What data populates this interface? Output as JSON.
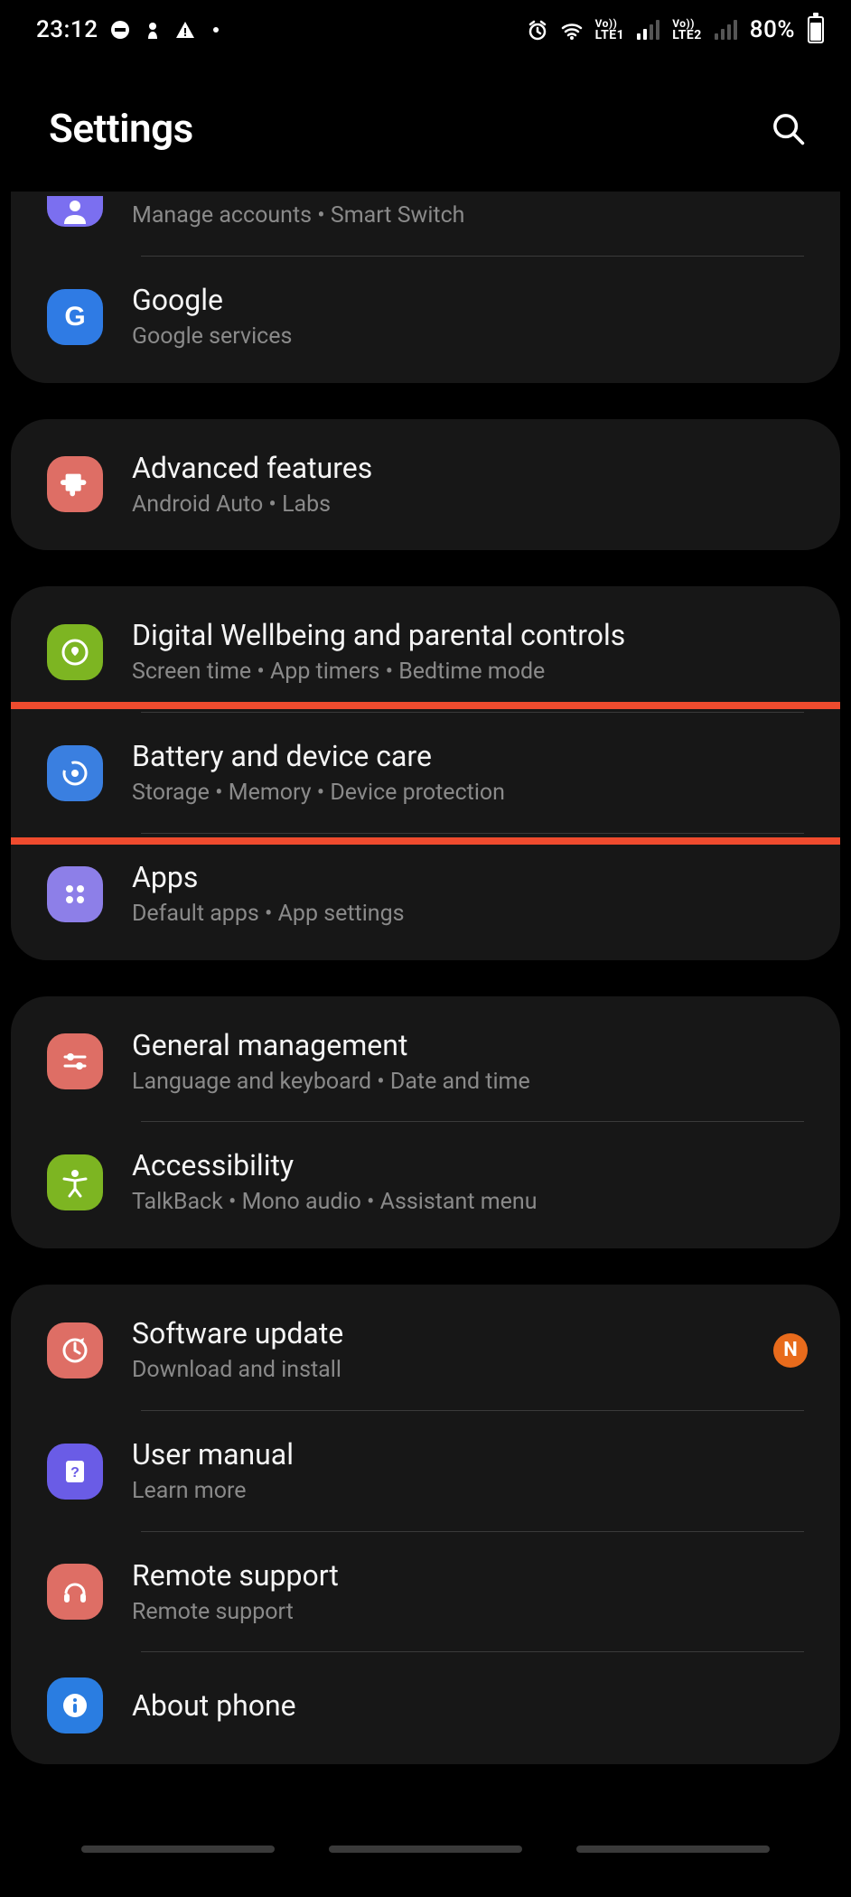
{
  "status": {
    "time": "23:12",
    "battery_pct": "80%",
    "lte1": "LTE1",
    "lte2": "LTE2",
    "vo1": "Vo))",
    "vo2": "Vo))"
  },
  "header": {
    "title": "Settings"
  },
  "groups": [
    {
      "id": "accounts-group",
      "first": true,
      "rows": [
        {
          "id": "accounts",
          "partial": true,
          "icon": "person-icon",
          "icon_color": "c-purple",
          "title": "",
          "subtitle": "Manage accounts  •  Smart Switch"
        },
        {
          "id": "google",
          "icon": "google-icon",
          "icon_color": "c-blue-g",
          "title": "Google",
          "subtitle": "Google services"
        }
      ]
    },
    {
      "id": "advanced-group",
      "rows": [
        {
          "id": "advanced-features",
          "icon": "puzzle-icon",
          "icon_color": "c-coral",
          "title": "Advanced features",
          "subtitle": "Android Auto  •  Labs"
        }
      ]
    },
    {
      "id": "wellbeing-group",
      "rows": [
        {
          "id": "digital-wellbeing",
          "icon": "wellbeing-icon",
          "icon_color": "c-green",
          "title": "Digital Wellbeing and parental controls",
          "subtitle": "Screen time  •  App timers  •  Bedtime mode"
        },
        {
          "id": "battery-device-care",
          "highlighted": true,
          "icon": "care-icon",
          "icon_color": "c-blue",
          "title": "Battery and device care",
          "subtitle": "Storage  •  Memory  •  Device protection"
        },
        {
          "id": "apps",
          "icon": "apps-icon",
          "icon_color": "c-lavender",
          "title": "Apps",
          "subtitle": "Default apps  •  App settings"
        }
      ]
    },
    {
      "id": "general-group",
      "rows": [
        {
          "id": "general-management",
          "icon": "sliders-icon",
          "icon_color": "c-coral",
          "title": "General management",
          "subtitle": "Language and keyboard  •  Date and time"
        },
        {
          "id": "accessibility",
          "icon": "accessibility-icon",
          "icon_color": "c-green",
          "title": "Accessibility",
          "subtitle": "TalkBack  •  Mono audio  •  Assistant menu"
        }
      ]
    },
    {
      "id": "about-group",
      "rows": [
        {
          "id": "software-update",
          "icon": "update-icon",
          "icon_color": "c-coral",
          "title": "Software update",
          "subtitle": "Download and install",
          "badge": "N"
        },
        {
          "id": "user-manual",
          "icon": "manual-icon",
          "icon_color": "c-violet",
          "title": "User manual",
          "subtitle": "Learn more"
        },
        {
          "id": "remote-support",
          "icon": "headset-icon",
          "icon_color": "c-coral",
          "title": "Remote support",
          "subtitle": "Remote support"
        },
        {
          "id": "about-phone",
          "icon": "info-icon",
          "icon_color": "c-blue2",
          "title": "About phone",
          "subtitle": ""
        }
      ]
    }
  ]
}
